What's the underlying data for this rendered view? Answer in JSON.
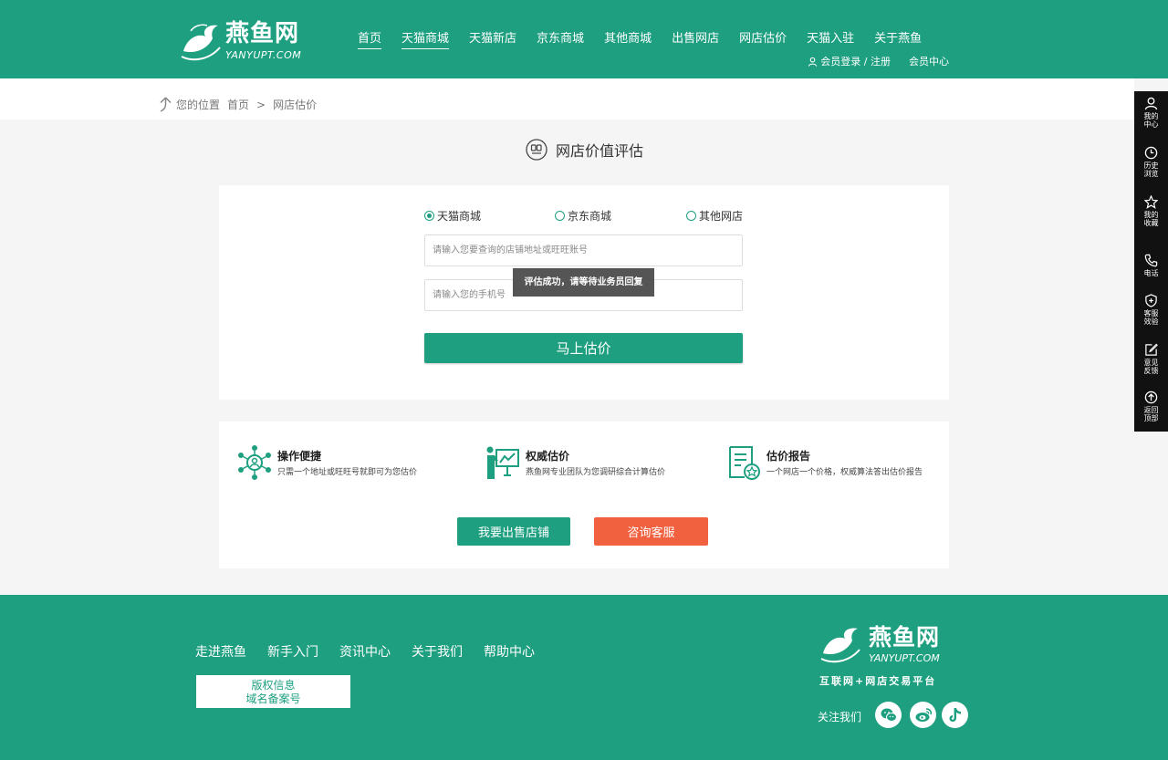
{
  "header": {
    "logo_cn": "燕鱼网",
    "logo_en": "YANYUPT.COM",
    "nav": [
      "首页",
      "天猫商城",
      "天猫新店",
      "京东商城",
      "其他商城",
      "出售网店",
      "网店估价",
      "天猫入驻",
      "关于燕鱼"
    ],
    "login": "会员登录 / 注册",
    "member_center": "会员中心"
  },
  "breadcrumb": {
    "label": "您的位置",
    "home": "首页",
    "sep": ">",
    "current": "网店估价"
  },
  "page_title": "网店价值评估",
  "form": {
    "radios": [
      {
        "label": "天猫商城",
        "selected": true
      },
      {
        "label": "京东商城",
        "selected": false
      },
      {
        "label": "其他网店",
        "selected": false
      }
    ],
    "shop_placeholder": "请输入您要查询的店铺地址或旺旺账号",
    "shop_value": "",
    "phone_placeholder": "请输入您的手机号",
    "phone_value": "",
    "toast": "评估成功，请等待业务员回复",
    "submit_label": "马上估价"
  },
  "features": [
    {
      "icon": "network-icon",
      "title": "操作便捷",
      "desc": "只需一个地址或旺旺号就即可为您估价"
    },
    {
      "icon": "presenter-chart-icon",
      "title": "权威估价",
      "desc": "燕鱼网专业团队为您调研综合计算估价"
    },
    {
      "icon": "report-icon",
      "title": "估价报告",
      "desc": "一个网店一个价格，权威算法答出估价报告"
    }
  ],
  "actions": {
    "sell_label": "我要出售店铺",
    "consult_label": "咨询客服"
  },
  "footer": {
    "links": [
      "走进燕鱼",
      "新手入门",
      "资讯中心",
      "关于我们",
      "帮助中心"
    ],
    "copyright": "版权信息",
    "icp": "域名备案号",
    "logo_cn": "燕鱼网",
    "logo_en": "YANYUPT.COM",
    "slogan": "互联网+网店交易平台",
    "follow": "关注我们",
    "social": [
      "wechat-icon",
      "weibo-icon",
      "tiktok-icon"
    ]
  },
  "sidebar": [
    {
      "icon": "user-icon",
      "label": "我的中心"
    },
    {
      "icon": "clock-icon",
      "label": "历史浏览"
    },
    {
      "icon": "star-icon",
      "label": "我的收藏"
    },
    {
      "icon": "phone-icon",
      "label": "电话"
    },
    {
      "icon": "shield-icon",
      "label": "客服效验"
    },
    {
      "icon": "edit-icon",
      "label": "意见反馈"
    },
    {
      "icon": "arrow-up-icon",
      "label": "返回顶部"
    }
  ],
  "colors": {
    "brand": "#1d9f80",
    "accent": "#f1603f",
    "sidebar": "#111111"
  }
}
